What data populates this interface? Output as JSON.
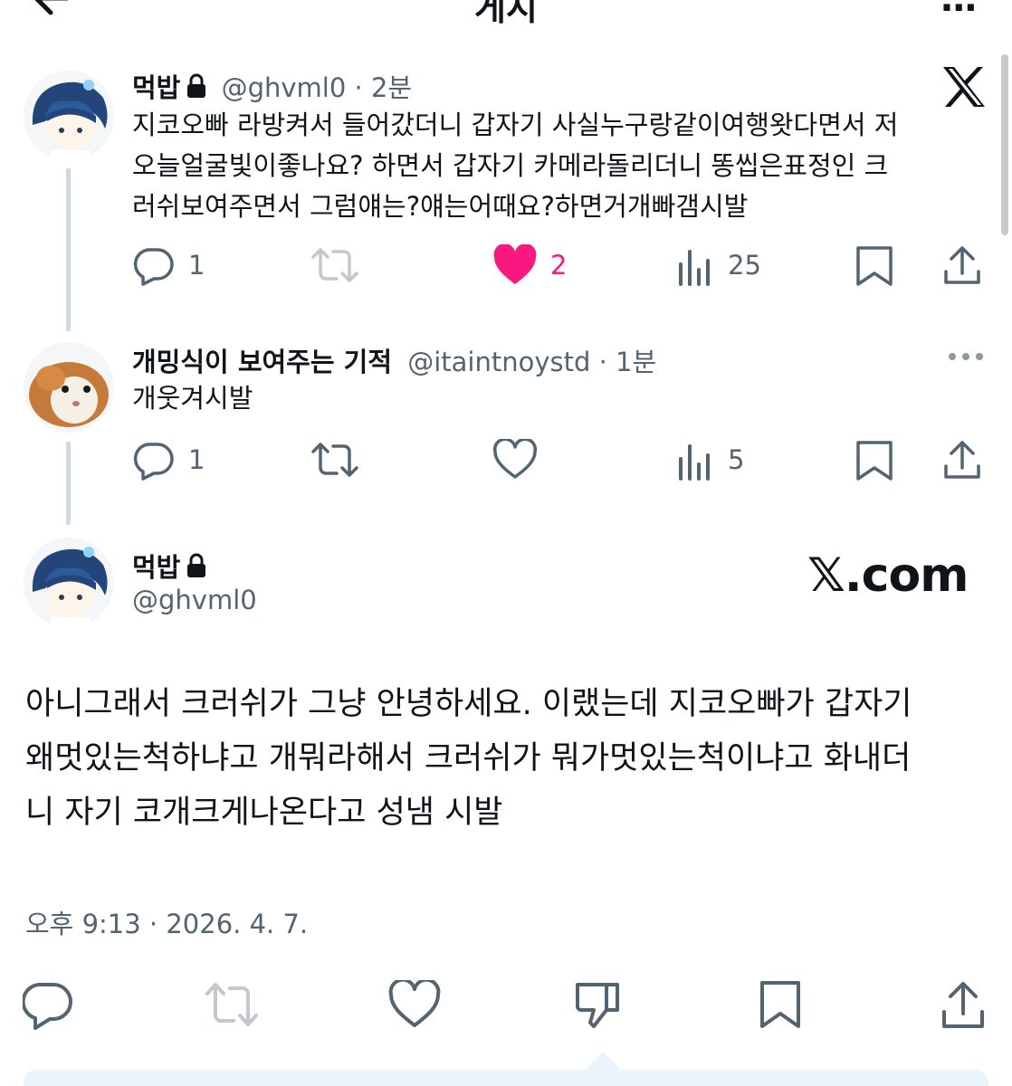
{
  "header": {
    "title": "게시",
    "back_icon": "arrow-left-icon",
    "more_label": "..."
  },
  "tweets": [
    {
      "name": "먹밥",
      "handle": "@ghvml0",
      "time": "· 2분",
      "text_lines": [
        "지코오빠 라방켜서 들어갔더니 갑자기 사실누구랑같이여행왓다면서 저",
        "오늘얼굴빛이좋나요? 하면서 갑자기 카메라돌리더니 똥씹은표정인 크",
        "러쉬보여주면서 그럼얘는?얘는어때요?하면거개빠갬시발"
      ],
      "replies": "1",
      "retweets": "",
      "likes": "2",
      "views": "25",
      "liked": true
    },
    {
      "name": "개밍식이 보여주는 기적",
      "handle": "@itaintnoystd",
      "time": "· 1분",
      "text_lines": [
        "개웃겨시발"
      ],
      "replies": "1",
      "retweets": "",
      "likes": "",
      "views": "5",
      "liked": false
    }
  ],
  "main_tweet": {
    "name": "먹밥",
    "handle": "@ghvml0",
    "text_lines": [
      "아니그래서 크러쉬가 그냥 안녕하세요. 이랬는데 지코오빠가 갑자기",
      "왜멋있는척하냐고 개뭐라해서 크러쉬가 뭐가멋있는척이냐고 화내더",
      "니 자기 코개크게나온다고 성냄 시발"
    ],
    "timestamp": "오후 9:13 · 2026. 4. 7."
  },
  "watermark": {
    "brand": "𝕏.com"
  },
  "colors": {
    "like": "#f91880",
    "icon": "#536471",
    "accent": "#1d9bf0",
    "thread_line": "#cfd9de"
  }
}
